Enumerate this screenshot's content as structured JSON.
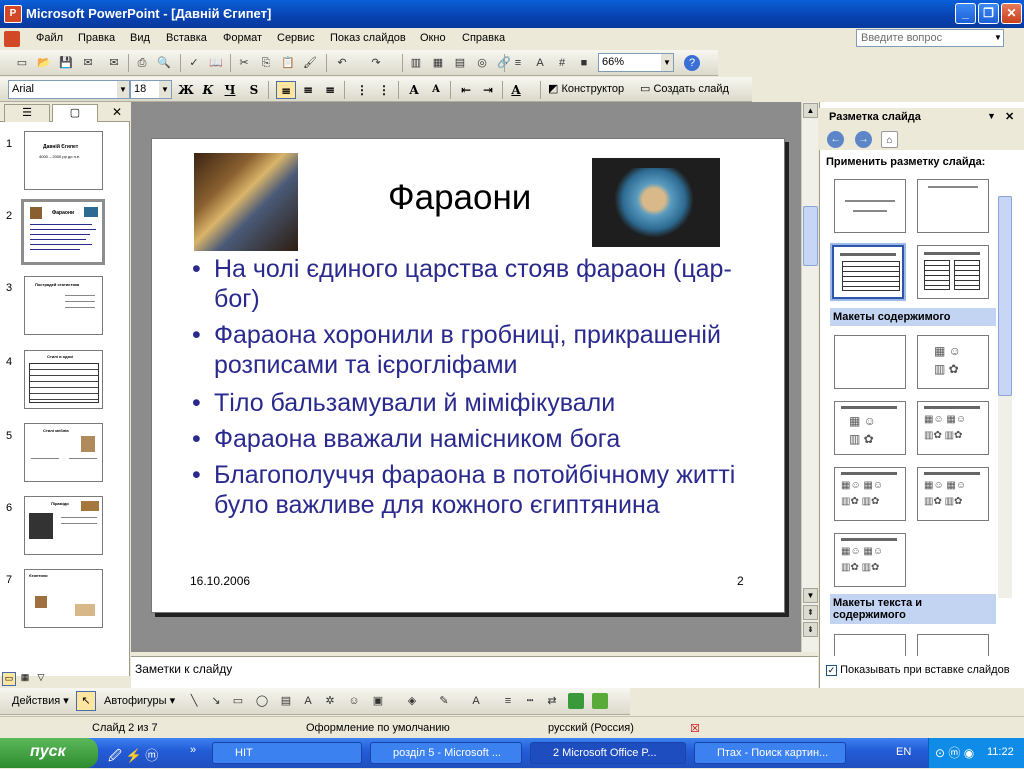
{
  "window": {
    "title": "Microsoft PowerPoint - [Давній Єгипет]"
  },
  "menu": {
    "items": [
      "Файл",
      "Правка",
      "Вид",
      "Вставка",
      "Формат",
      "Сервис",
      "Показ слайдов",
      "Окно",
      "Справка"
    ],
    "ask_placeholder": "Введите вопрос"
  },
  "toolbar": {
    "zoom": "66%"
  },
  "format_toolbar": {
    "font": "Arial",
    "size": "18",
    "bold": "Ж",
    "italic": "К",
    "underline": "Ч",
    "shadow": "S",
    "designer": "Конструктор",
    "new_slide": "Создать слайд"
  },
  "thumbnails": [
    {
      "num": "1",
      "title": "Давній Єгипет",
      "sub": "4000 – 2000 рр до н.е."
    },
    {
      "num": "2",
      "title": "Фараони"
    },
    {
      "num": "3",
      "title": "Пострадей статистика"
    },
    {
      "num": "4",
      "title": "Стилі в одязі"
    },
    {
      "num": "5",
      "title": "Стилі меблів"
    },
    {
      "num": "6",
      "title": "Піраміди"
    },
    {
      "num": "7",
      "title": "Єгиптяни"
    }
  ],
  "slide": {
    "title": "Фараони",
    "bullets": [
      "На чолі єдиного царства стояв фараон (цар-бог)",
      "Фараона хоронили в гробниці, прикрашеній розписами та ієрогліфами",
      "Тіло бальзамували й міміфікували",
      "Фараона вважали намісником бога",
      "Благополуччя фараона в потойбічному житті було важливе для кожного єгиптянина"
    ],
    "date": "16.10.2006",
    "number": "2"
  },
  "notes": {
    "placeholder": "Заметки к слайду"
  },
  "taskpane": {
    "title": "Разметка слайда",
    "apply_label": "Применить разметку слайда:",
    "section_content": "Макеты содержимого",
    "section_text_content": "Макеты текста и содержимого",
    "show_on_insert": "Показывать при вставке слайдов"
  },
  "drawing_toolbar": {
    "actions": "Действия",
    "autoshapes": "Автофигуры"
  },
  "status": {
    "slide": "Слайд 2 из 7",
    "design": "Оформление по умолчанию",
    "language": "русский (Россия)"
  },
  "taskbar": {
    "start": "пуск",
    "tasks": [
      "HIT",
      "розділ 5 - Microsoft ...",
      "2 Microsoft Office P...",
      "Птах - Поиск картин..."
    ],
    "lang": "EN",
    "clock": "11:22"
  },
  "colors": {
    "bullet_text": "#2a2a8e",
    "title_bar": "#0842b0",
    "taskbar": "#245dd8",
    "start": "#2e8b2e"
  }
}
